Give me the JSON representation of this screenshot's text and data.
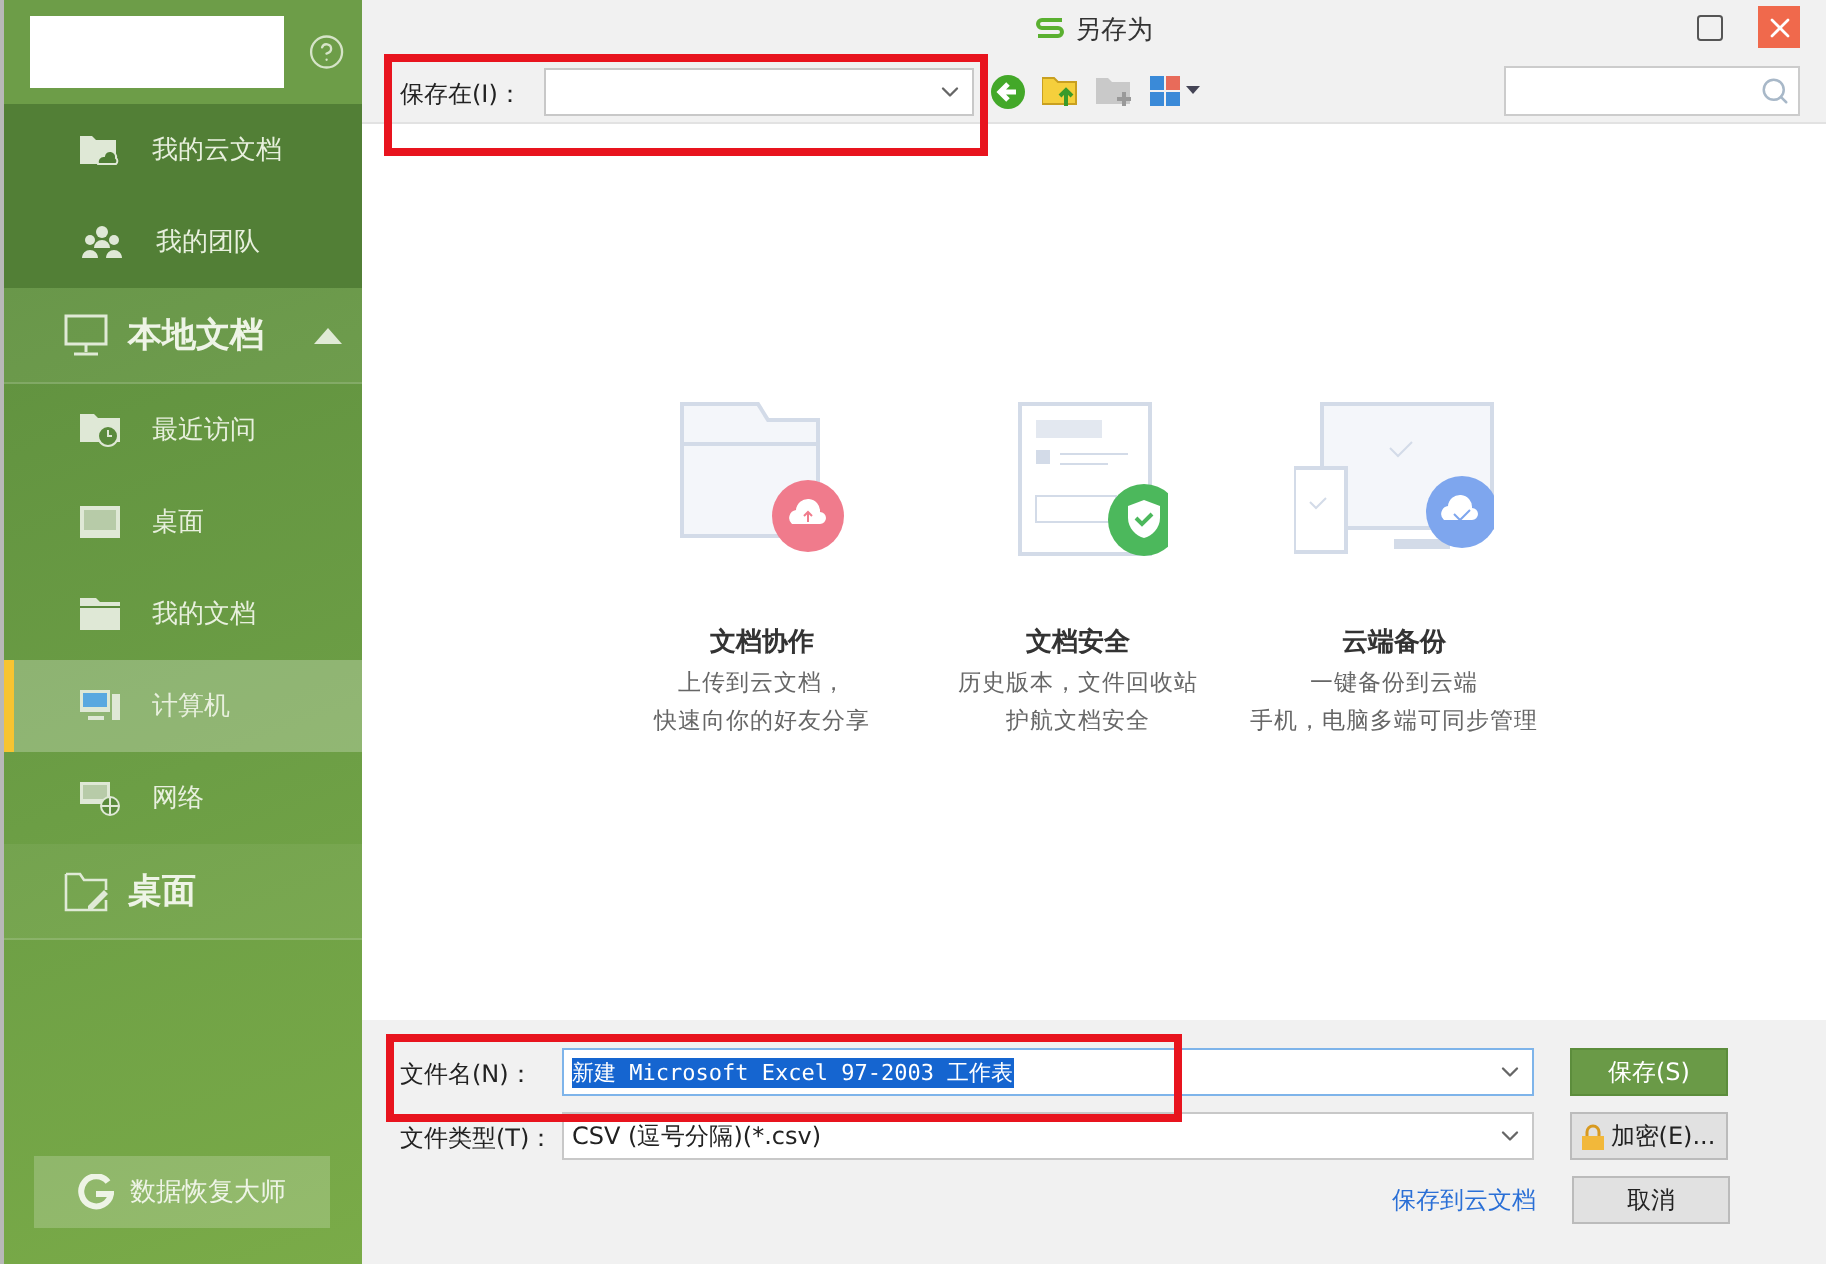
{
  "window": {
    "title": "另存为"
  },
  "sidebar": {
    "items": [
      {
        "kind": "item",
        "label": "我的云文档",
        "selected": false
      },
      {
        "kind": "item",
        "label": "我的团队",
        "selected": false
      },
      {
        "kind": "section",
        "label": "本地文档",
        "expanded": true
      },
      {
        "kind": "item",
        "label": "最近访问",
        "selected": false
      },
      {
        "kind": "item",
        "label": "桌面",
        "selected": false
      },
      {
        "kind": "item",
        "label": "我的文档",
        "selected": false
      },
      {
        "kind": "item",
        "label": "计算机",
        "selected": true
      },
      {
        "kind": "item",
        "label": "网络",
        "selected": false
      },
      {
        "kind": "section",
        "label": "桌面"
      }
    ],
    "footer_button": "数据恢复大师"
  },
  "toolbar": {
    "location_label": "保存在(I)："
  },
  "features": [
    {
      "title": "文档协作",
      "lines": [
        "上传到云文档，",
        "快速向你的好友分享"
      ]
    },
    {
      "title": "文档安全",
      "lines": [
        "历史版本，文件回收站",
        "护航文档安全"
      ]
    },
    {
      "title": "云端备份",
      "lines": [
        "一键备份到云端",
        "手机，电脑多端可同步管理"
      ]
    }
  ],
  "form": {
    "filename_label": "文件名(N)：",
    "filename": "新建 Microsoft Excel 97-2003 工作表",
    "filename_text_selected": true,
    "type_label": "文件类型(T)：",
    "file_type": "CSV (逗号分隔)(*.csv)",
    "cloud_link": "保存到云文档"
  },
  "buttons": {
    "save": "保存(S)",
    "encrypt": "加密(E)...",
    "cancel": "取消"
  }
}
